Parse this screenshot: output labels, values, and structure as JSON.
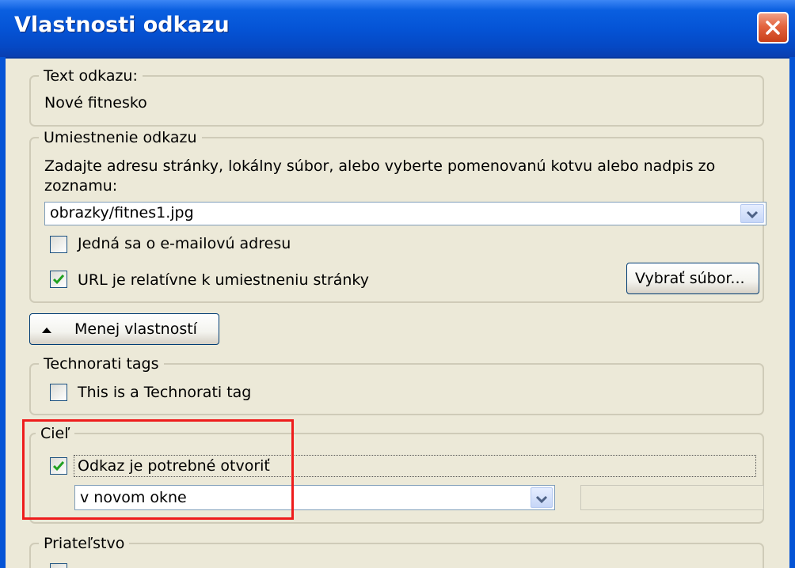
{
  "window": {
    "title": "Vlastnosti odkazu"
  },
  "link_text": {
    "legend": "Text odkazu:",
    "value": "Nové fitnesko"
  },
  "location": {
    "legend": "Umiestnenie odkazu",
    "instruction_line1": "Zadajte adresu stránky, lokálny súbor, alebo vyberte pomenovanú kotvu alebo nadpis zo",
    "instruction_line2": "zoznamu:",
    "url_value": "obrazky/fitnes1.jpg",
    "email_label": "Jedná sa o e-mailovú adresu",
    "email_checked": false,
    "relative_label": "URL je relatívne k umiestneniu stránky",
    "relative_checked": true,
    "choose_file_button": "Vybrať súbor..."
  },
  "toggle_button": {
    "label": "Menej vlastností"
  },
  "technorati": {
    "legend": "Technorati tags",
    "checkbox_label": "This is a Technorati tag",
    "checked": false
  },
  "target": {
    "legend": "Cieľ",
    "checkbox_label": "Odkaz je potrebné otvoriť",
    "checked": true,
    "select_value": "v novom okne"
  },
  "friendship": {
    "legend": "Priateľstvo"
  },
  "colors": {
    "title_bar": "#0554d6",
    "dialog_bg": "#ece9d8",
    "highlight": "#ee1c1c",
    "checkmark": "#21a121"
  }
}
